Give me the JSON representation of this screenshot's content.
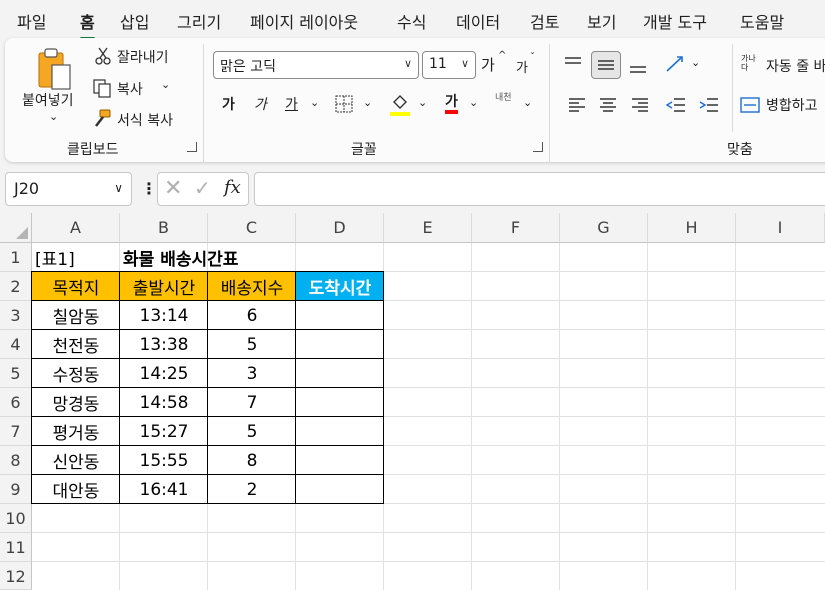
{
  "menu": {
    "tabs": [
      "파일",
      "홈",
      "삽입",
      "그리기",
      "페이지 레이아웃",
      "수식",
      "데이터",
      "검토",
      "보기",
      "개발 도구",
      "도움말"
    ],
    "active": "홈"
  },
  "ribbon": {
    "clipboard": {
      "paste": "붙여넣기",
      "cut": "잘라내기",
      "copy": "복사",
      "format_painter": "서식 복사",
      "label": "클립보드"
    },
    "font": {
      "font_name": "맑은 고딕",
      "font_size": "11",
      "grow": "가",
      "shrink": "가",
      "bold": "가",
      "italic": "가",
      "underline": "가",
      "phonetic": "가",
      "phonetic_top": "내천",
      "label": "글꼴"
    },
    "alignment": {
      "wrap_icon": "가나다",
      "wrap_text": "자동 줄 바",
      "merge": "병합하고",
      "label": "맞춤"
    },
    "colors": {
      "fill": "#ffff00",
      "font": "#ff0000",
      "accent": "#107c41"
    }
  },
  "formula_bar": {
    "name_box": "J20",
    "fx": "fx",
    "formula": ""
  },
  "sheet": {
    "columns": [
      "A",
      "B",
      "C",
      "D",
      "E",
      "F",
      "G",
      "H",
      "I"
    ],
    "rows": [
      "1",
      "2",
      "3",
      "4",
      "5",
      "6",
      "7",
      "8",
      "9",
      "10",
      "11",
      "12"
    ],
    "a1": "[표1]",
    "title": "화물 배송시간표",
    "headers": [
      "목적지",
      "출발시간",
      "배송지수",
      "도착시간"
    ],
    "header_colors": {
      "orange": "#ffc000",
      "blue": "#00b0f0"
    },
    "data": [
      [
        "칠암동",
        "13:14",
        "6",
        ""
      ],
      [
        "천전동",
        "13:38",
        "5",
        ""
      ],
      [
        "수정동",
        "14:25",
        "3",
        ""
      ],
      [
        "망경동",
        "14:58",
        "7",
        ""
      ],
      [
        "평거동",
        "15:27",
        "5",
        ""
      ],
      [
        "신안동",
        "15:55",
        "8",
        ""
      ],
      [
        "대안동",
        "16:41",
        "2",
        ""
      ]
    ]
  }
}
